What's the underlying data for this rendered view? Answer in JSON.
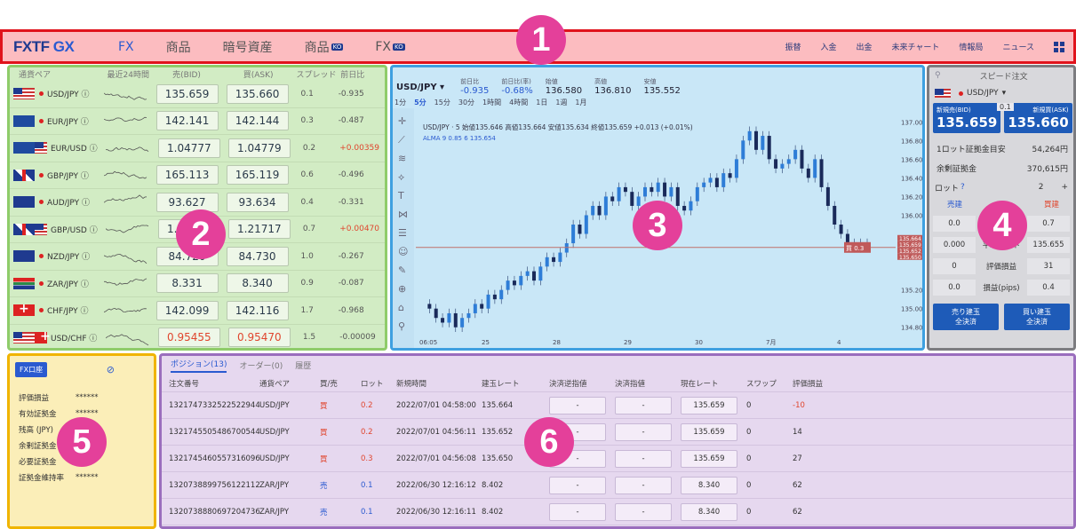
{
  "header": {
    "logo_a": "FXTF",
    "logo_b": "GX",
    "tabs": [
      {
        "label": "FX",
        "badge": ""
      },
      {
        "label": "商品",
        "badge": ""
      },
      {
        "label": "暗号資産",
        "badge": ""
      },
      {
        "label": "商品",
        "badge": "KO"
      },
      {
        "label": "FX",
        "badge": "KO"
      }
    ],
    "links": [
      "振替",
      "入金",
      "出金",
      "未来チャート",
      "情報局",
      "ニュース"
    ]
  },
  "badges": [
    "1",
    "2",
    "3",
    "4",
    "5",
    "6"
  ],
  "ratelist": {
    "headers": [
      "通貨ペア",
      "最近24時間",
      "売(BID)",
      "買(ASK)",
      "スプレッド",
      "前日比"
    ],
    "rows": [
      {
        "flag": "us",
        "flag2": "",
        "pair": "USD/JPY ⓘ",
        "bid": "135.659",
        "ask": "135.660",
        "spread": "0.1",
        "chg": "-0.935",
        "pos": false,
        "red": false
      },
      {
        "flag": "eu",
        "flag2": "",
        "pair": "EUR/JPY ⓘ",
        "bid": "142.141",
        "ask": "142.144",
        "spread": "0.3",
        "chg": "-0.487",
        "pos": false,
        "red": false
      },
      {
        "flag": "eu",
        "flag2": "us",
        "pair": "EUR/USD ⓘ",
        "bid": "1.04777",
        "ask": "1.04779",
        "spread": "0.2",
        "chg": "+0.00359",
        "pos": true,
        "red": false
      },
      {
        "flag": "gb",
        "flag2": "",
        "pair": "GBP/JPY ⓘ",
        "bid": "165.113",
        "ask": "165.119",
        "spread": "0.6",
        "chg": "-0.496",
        "pos": false,
        "red": false
      },
      {
        "flag": "au",
        "flag2": "",
        "pair": "AUD/JPY ⓘ",
        "bid": "93.627",
        "ask": "93.634",
        "spread": "0.4",
        "chg": "-0.331",
        "pos": false,
        "red": false
      },
      {
        "flag": "gb",
        "flag2": "us",
        "pair": "GBP/USD ⓘ",
        "bid": "1.21710",
        "ask": "1.21717",
        "spread": "0.7",
        "chg": "+0.00470",
        "pos": true,
        "red": false
      },
      {
        "flag": "nz",
        "flag2": "",
        "pair": "NZD/JPY ⓘ",
        "bid": "84.720",
        "ask": "84.730",
        "spread": "1.0",
        "chg": "-0.267",
        "pos": false,
        "red": false
      },
      {
        "flag": "za",
        "flag2": "",
        "pair": "ZAR/JPY ⓘ",
        "bid": "8.331",
        "ask": "8.340",
        "spread": "0.9",
        "chg": "-0.087",
        "pos": false,
        "red": false
      },
      {
        "flag": "ch",
        "flag2": "",
        "pair": "CHF/JPY ⓘ",
        "bid": "142.099",
        "ask": "142.116",
        "spread": "1.7",
        "chg": "-0.968",
        "pos": false,
        "red": false
      },
      {
        "flag": "us",
        "flag2": "ch",
        "pair": "USD/CHF ⓘ",
        "bid": "0.95455",
        "ask": "0.95470",
        "spread": "1.5",
        "chg": "-0.00009",
        "pos": false,
        "red": true
      }
    ]
  },
  "chart": {
    "symbol": "USD/JPY",
    "stats_labels": [
      "前日比",
      "前日比(率)",
      "始値",
      "高値",
      "安値"
    ],
    "stats_values": [
      "-0.935",
      "-0.68%",
      "136.580",
      "136.810",
      "135.552"
    ],
    "timeframes": [
      "1分",
      "5分",
      "15分",
      "30分",
      "1時間",
      "4時間",
      "1日",
      "1週",
      "1月"
    ],
    "info": "USD/JPY · 5  始値135.646 高値135.664 安値135.634 終値135.659 +0.013 (+0.01%)",
    "alma": "ALMA 9 0.85 6  135.654",
    "yticks": [
      "137.000",
      "136.800",
      "136.600",
      "136.400",
      "136.200",
      "136.000",
      "135.200",
      "135.000",
      "134.800"
    ],
    "price_tags": [
      "135.664",
      "135.659",
      "135.652",
      "135.650"
    ],
    "pos_label": "買",
    "pos_value": "0.3",
    "xticks": [
      "06:05",
      "25",
      "28",
      "29",
      "30",
      "7月",
      "4"
    ],
    "prices": [
      135.05,
      135.0,
      134.9,
      134.85,
      134.95,
      134.8,
      134.9,
      134.95,
      135.05,
      135.0,
      135.15,
      135.1,
      135.2,
      135.3,
      135.25,
      135.35,
      135.4,
      135.3,
      135.45,
      135.55,
      135.5,
      135.6,
      135.7,
      135.9,
      135.8,
      136.0,
      136.1,
      136.0,
      136.2,
      136.15,
      136.3,
      136.25,
      136.1,
      136.2,
      136.3,
      136.25,
      136.35,
      136.2,
      136.3,
      136.1,
      136.05,
      136.15,
      136.3,
      136.35,
      136.4,
      136.3,
      136.45,
      136.4,
      136.6,
      136.8,
      136.9,
      136.7,
      136.85,
      136.6,
      136.5,
      136.55,
      136.6,
      136.7,
      136.5,
      136.4,
      136.6,
      136.3,
      136.1,
      135.9,
      135.8,
      135.7,
      135.65,
      135.7,
      135.66
    ]
  },
  "speed": {
    "title": "スピード注文",
    "pair": "USD/JPY",
    "sell_label": "新規売(BID)",
    "buy_label": "新規買(ASK)",
    "spread": "0.1",
    "sell_price": "135.659",
    "buy_price": "135.660",
    "kv": [
      {
        "k": "1ロット証拠金目安",
        "v": "54,264円"
      },
      {
        "k": "余剰証拠金",
        "v": "370,615円"
      }
    ],
    "lot_label": "ロット",
    "lot_value": "2",
    "col_sell": "売建",
    "col_buy": "買建",
    "rows": [
      {
        "l": "0.0",
        "m": "ロット",
        "r": "0.7"
      },
      {
        "l": "0.000",
        "m": "平均レート",
        "r": "135.655"
      },
      {
        "l": "0",
        "m": "評価損益",
        "r": "31"
      },
      {
        "l": "0.0",
        "m": "損益(pips)",
        "r": "0.4"
      }
    ],
    "close_sell": [
      "売り建玉",
      "全決済"
    ],
    "close_buy": [
      "買い建玉",
      "全決済"
    ]
  },
  "account": {
    "btn": "FX口座",
    "rows": [
      {
        "k": "評価損益",
        "v": "******"
      },
      {
        "k": "有効証拠金",
        "v": "******"
      },
      {
        "k": "残高 (JPY)",
        "v": "******"
      },
      {
        "k": "余剰証拠金",
        "v": "******"
      },
      {
        "k": "必要証拠金",
        "v": "******"
      },
      {
        "k": "証拠金維持率",
        "v": "******"
      }
    ]
  },
  "positions": {
    "tabs": [
      "ポジション(13)",
      "オーダー(0)",
      "履歴"
    ],
    "headers": [
      "注文番号",
      "通貨ペア",
      "買/売",
      "ロット",
      "新規時間",
      "建玉レート",
      "決済逆指値",
      "決済指値",
      "現在レート",
      "スワップ",
      "評価損益"
    ],
    "rows": [
      {
        "id": "1321747332522522944",
        "pair": "USD/JPY",
        "side": "買",
        "lot": "0.2",
        "time": "2022/07/01 04:58:00",
        "rate": "135.664",
        "stop": "-",
        "limit": "-",
        "cur": "135.659",
        "swap": "0",
        "pl": "-10",
        "buy": true,
        "neg": true
      },
      {
        "id": "1321745505486700544",
        "pair": "USD/JPY",
        "side": "買",
        "lot": "0.2",
        "time": "2022/07/01 04:56:11",
        "rate": "135.652",
        "stop": "-",
        "limit": "-",
        "cur": "135.659",
        "swap": "0",
        "pl": "14",
        "buy": true,
        "neg": false
      },
      {
        "id": "1321745460557316096",
        "pair": "USD/JPY",
        "side": "買",
        "lot": "0.3",
        "time": "2022/07/01 04:56:08",
        "rate": "135.650",
        "stop": "-",
        "limit": "-",
        "cur": "135.659",
        "swap": "0",
        "pl": "27",
        "buy": true,
        "neg": false
      },
      {
        "id": "1320738899756122112",
        "pair": "ZAR/JPY",
        "side": "売",
        "lot": "0.1",
        "time": "2022/06/30 12:16:12",
        "rate": "8.402",
        "stop": "-",
        "limit": "-",
        "cur": "8.340",
        "swap": "0",
        "pl": "62",
        "buy": false,
        "neg": false
      },
      {
        "id": "1320738880697204736",
        "pair": "ZAR/JPY",
        "side": "売",
        "lot": "0.1",
        "time": "2022/06/30 12:16:11",
        "rate": "8.402",
        "stop": "-",
        "limit": "-",
        "cur": "8.340",
        "swap": "0",
        "pl": "62",
        "buy": false,
        "neg": false
      }
    ]
  }
}
